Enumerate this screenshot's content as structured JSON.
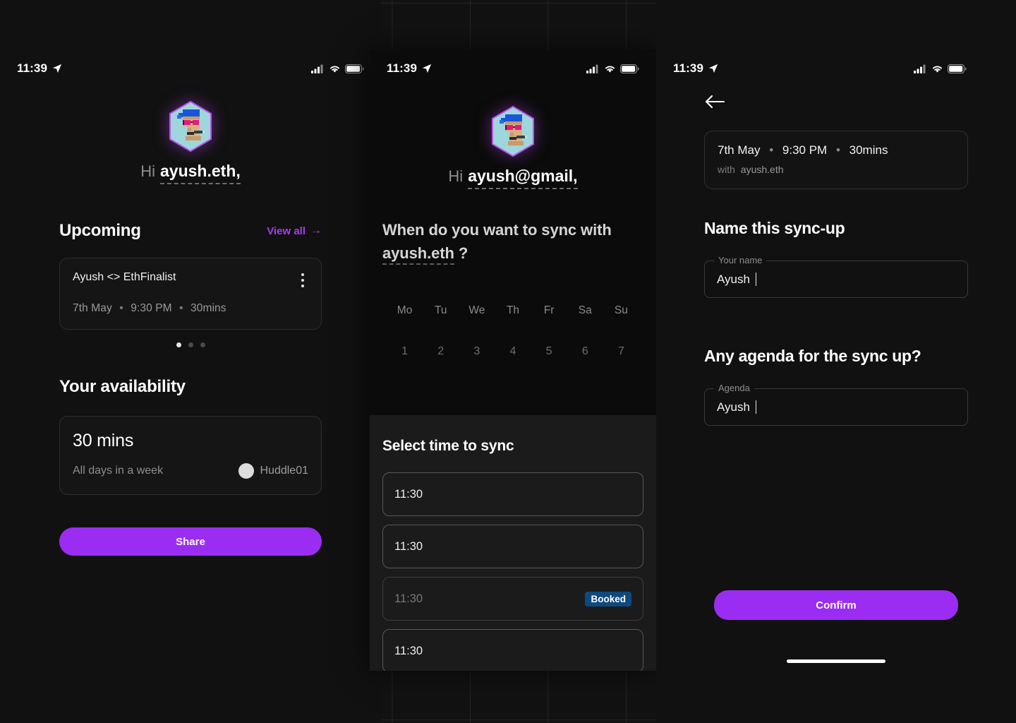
{
  "theme": {
    "accent_purple": "#9b2df2",
    "link_purple": "#a63cf0",
    "badge_blue": "#0e4a7e",
    "bg": "#111111",
    "panel_dark": "#0b0b0b",
    "sheet": "#1b1b1b"
  },
  "status_bar": {
    "time": "11:39",
    "location_icon": "location-arrow-icon",
    "cellular_icon": "cellular-signal-icon",
    "wifi_icon": "wifi-icon",
    "battery_icon": "battery-icon"
  },
  "screen_home": {
    "avatar_alt": "pixel-art-hexagon-avatar",
    "greeting_prefix": "Hi",
    "greeting_name": "ayush.eth,",
    "upcoming": {
      "title": "Upcoming",
      "view_all_label": "View all",
      "view_all_arrow": "→",
      "card": {
        "title": "Ayush <> EthFinalist",
        "date": "7th May",
        "time": "9:30 PM",
        "duration": "30mins",
        "separator": "•",
        "menu_icon": "kebab-menu-icon"
      },
      "pagination": {
        "total": 3,
        "active_index": 0
      }
    },
    "availability": {
      "title": "Your availability",
      "duration": "30 mins",
      "subtitle": "All days in a week",
      "provider": "Huddle01",
      "provider_icon": "huddle01-logo-icon"
    },
    "share_button": "Share"
  },
  "screen_picker": {
    "avatar_alt": "pixel-art-hexagon-avatar",
    "greeting_prefix": "Hi",
    "greeting_name": "ayush@gmail,",
    "question_line1": "When do you want to sync with",
    "question_name": "ayush.eth",
    "question_mark": "?",
    "calendar": {
      "day_names": [
        "Mo",
        "Tu",
        "We",
        "Th",
        "Fr",
        "Sa",
        "Su"
      ],
      "day_numbers": [
        "1",
        "2",
        "3",
        "4",
        "5",
        "6",
        "7"
      ]
    },
    "sheet_title": "Select time to sync",
    "slots": [
      {
        "time": "11:30",
        "booked": false,
        "badge": ""
      },
      {
        "time": "11:30",
        "booked": false,
        "badge": ""
      },
      {
        "time": "11:30",
        "booked": true,
        "badge": "Booked"
      },
      {
        "time": "11:30",
        "booked": false,
        "badge": ""
      }
    ]
  },
  "screen_confirm": {
    "back_icon": "arrow-left-icon",
    "summary": {
      "date": "7th May",
      "time": "9:30 PM",
      "duration": "30mins",
      "separator": "•",
      "with_prefix": "with",
      "with_name": "ayush.eth"
    },
    "name_section_title": "Name this sync-up",
    "name_field": {
      "label": "Your name",
      "value": "Ayush"
    },
    "agenda_section_title": "Any agenda for the sync up?",
    "agenda_field": {
      "label": "Agenda",
      "value": "Ayush"
    },
    "confirm_button": "Confirm"
  }
}
